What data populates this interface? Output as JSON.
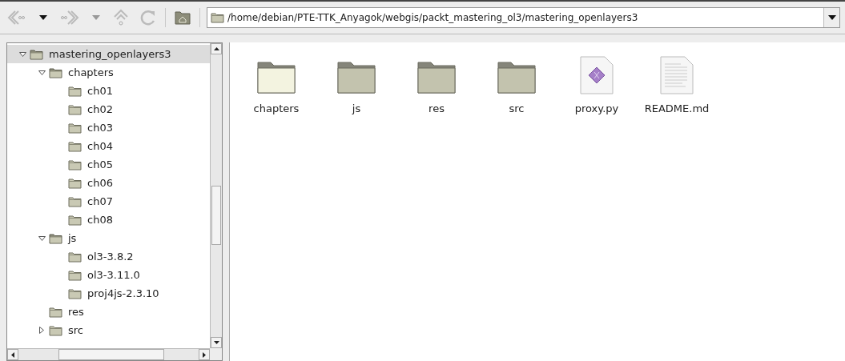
{
  "toolbar": {
    "location": "/home/debian/PTE-TTK_Anyagok/webgis/packt_mastering_ol3/mastering_openlayers3"
  },
  "tree": [
    {
      "label": "mastering_openlayers3",
      "selected": true,
      "expanded": true,
      "children": [
        {
          "label": "chapters",
          "selected": false,
          "expanded": true,
          "children": [
            {
              "label": "ch01",
              "selected": false
            },
            {
              "label": "ch02",
              "selected": false
            },
            {
              "label": "ch03",
              "selected": false
            },
            {
              "label": "ch04",
              "selected": false
            },
            {
              "label": "ch05",
              "selected": false
            },
            {
              "label": "ch06",
              "selected": false
            },
            {
              "label": "ch07",
              "selected": false
            },
            {
              "label": "ch08",
              "selected": false
            }
          ]
        },
        {
          "label": "js",
          "selected": false,
          "expanded": true,
          "children": [
            {
              "label": "ol3-3.8.2",
              "selected": false
            },
            {
              "label": "ol3-3.11.0",
              "selected": false
            },
            {
              "label": "proj4js-2.3.10",
              "selected": false
            }
          ]
        },
        {
          "label": "res",
          "selected": false
        },
        {
          "label": "src",
          "selected": false,
          "expanded": false
        }
      ]
    }
  ],
  "files": [
    {
      "name": "chapters",
      "kind": "folder",
      "selected": true
    },
    {
      "name": "js",
      "kind": "folder",
      "selected": false
    },
    {
      "name": "res",
      "kind": "folder",
      "selected": false
    },
    {
      "name": "src",
      "kind": "folder",
      "selected": false
    },
    {
      "name": "proxy.py",
      "kind": "script",
      "selected": false
    },
    {
      "name": "README.md",
      "kind": "text",
      "selected": false
    }
  ]
}
